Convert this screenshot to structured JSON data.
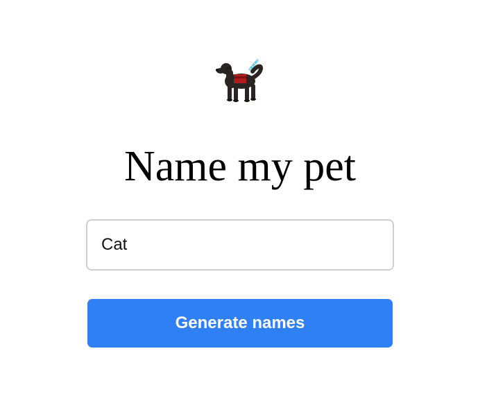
{
  "header": {
    "icon": "service-dog-icon",
    "title": "Name my pet"
  },
  "form": {
    "animal_input_value": "Cat",
    "submit_label": "Generate names"
  },
  "colors": {
    "button_bg": "#2f80f4",
    "button_text": "#ffffff",
    "input_border": "#cfcfcf"
  }
}
